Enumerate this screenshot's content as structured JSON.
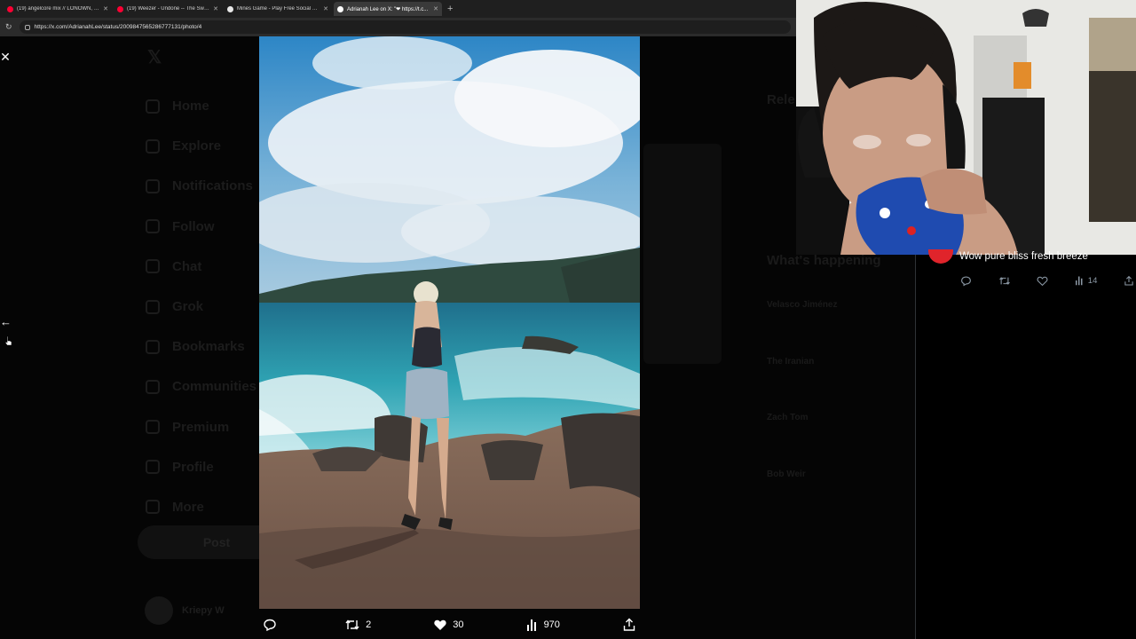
{
  "browser": {
    "tabs": [
      {
        "title": "(19) angelcore mix // LONOWN, a...",
        "favicon_color": "#ff0033",
        "active": false
      },
      {
        "title": "(19) Weezer - Undone -- The Swe...",
        "favicon_color": "#ff0033",
        "active": false
      },
      {
        "title": "Mines Game - Play Free Social Ca...",
        "favicon_color": "#e8e8e8",
        "active": false
      },
      {
        "title": "Adrianah Lee on X: \"❤ https://t.c...",
        "favicon_color": "#ffffff",
        "active": true
      }
    ],
    "new_tab": "+",
    "url": "https://x.com/AdrianahLee/status/2009847565286777131/photo/4"
  },
  "x_background": {
    "logo": "𝕏",
    "nav_items": [
      "Home",
      "Explore",
      "Notifications",
      "Follow",
      "Chat",
      "Grok",
      "Bookmarks",
      "Communities",
      "Premium",
      "Profile",
      "More"
    ],
    "post_button": "Post",
    "account_name": "Kriepy W",
    "relevant_title": "Rele",
    "whats_happening": "What's happening",
    "trends": [
      "Velasco Jiménez",
      "The Iranian",
      "Zach Tom",
      "Bob Weir"
    ]
  },
  "media_viewer": {
    "close": "✕",
    "prev": "←",
    "photo_alt": "Woman standing on rocks by the ocean"
  },
  "post_actions": {
    "reply_count": "",
    "retweet_count": "2",
    "like_count": "30",
    "view_count": "970"
  },
  "reply": {
    "text": "Wow pure bliss fresh breeze",
    "view_count": "14"
  },
  "colors": {
    "background": "#000000",
    "icon": "#ffffff",
    "muted": "#8b98a5",
    "reply_avatar": "#e0242b"
  }
}
